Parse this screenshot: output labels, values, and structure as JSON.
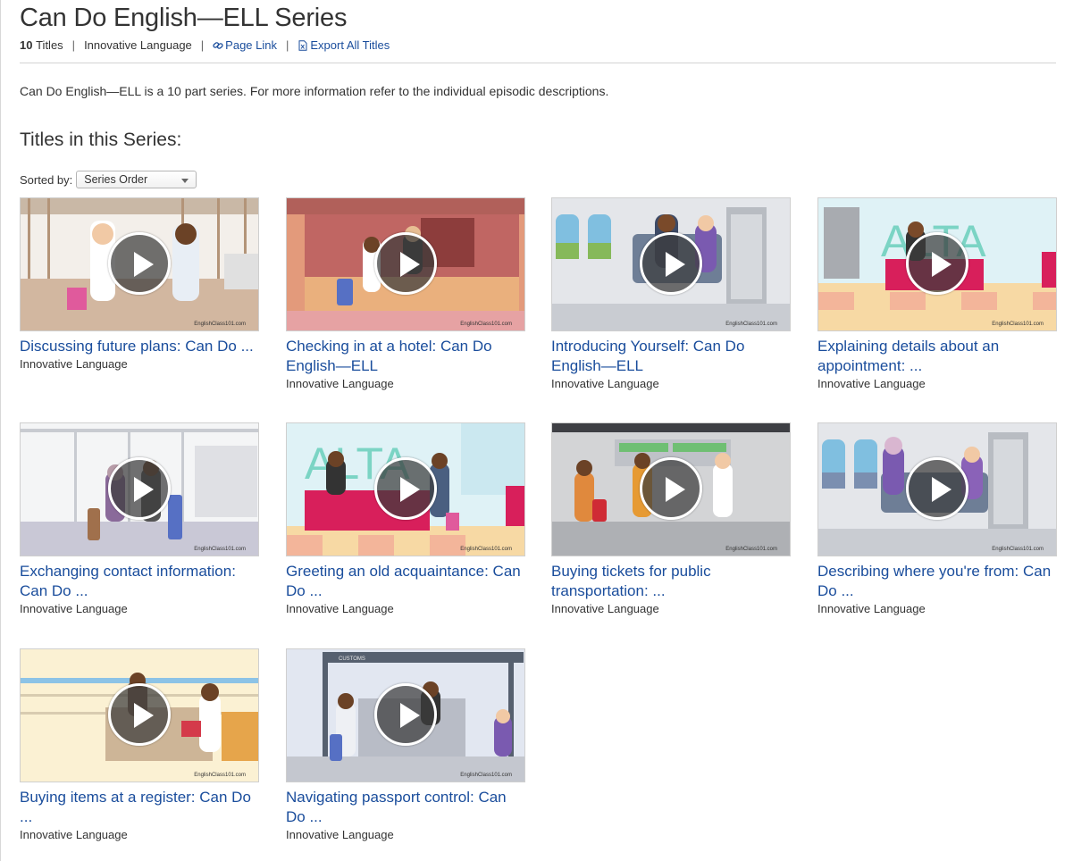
{
  "series": {
    "title": "Can Do English—ELL Series",
    "count": "10",
    "count_label": "Titles",
    "publisher": "Innovative Language",
    "page_link_label": "Page Link",
    "export_label": "Export All Titles",
    "description": "Can Do English—ELL is a 10 part series. For more information refer to the individual episodic descriptions."
  },
  "section_heading": "Titles in this Series:",
  "sort": {
    "label": "Sorted by:",
    "selected": "Series Order"
  },
  "watermark": "EnglishClass101.com",
  "titles": [
    {
      "title": "Discussing future plans: Can Do ...",
      "publisher": "Innovative Language"
    },
    {
      "title": "Checking in at a hotel: Can Do English—ELL",
      "publisher": "Innovative Language"
    },
    {
      "title": "Introducing Yourself: Can Do English—ELL",
      "publisher": "Innovative Language"
    },
    {
      "title": "Explaining details about an appointment: ...",
      "publisher": "Innovative Language"
    },
    {
      "title": "Exchanging contact information: Can Do ...",
      "publisher": "Innovative Language"
    },
    {
      "title": "Greeting an old acquaintance: Can Do ...",
      "publisher": "Innovative Language"
    },
    {
      "title": "Buying tickets for public transportation: ...",
      "publisher": "Innovative Language"
    },
    {
      "title": "Describing where you're from: Can Do ...",
      "publisher": "Innovative Language"
    },
    {
      "title": "Buying items at a register: Can Do ...",
      "publisher": "Innovative Language"
    },
    {
      "title": "Navigating passport control: Can Do ...",
      "publisher": "Innovative Language"
    }
  ],
  "scene_labels": {
    "hotel_sign": "ALTA",
    "customs_sign": "CUSTOMS"
  }
}
